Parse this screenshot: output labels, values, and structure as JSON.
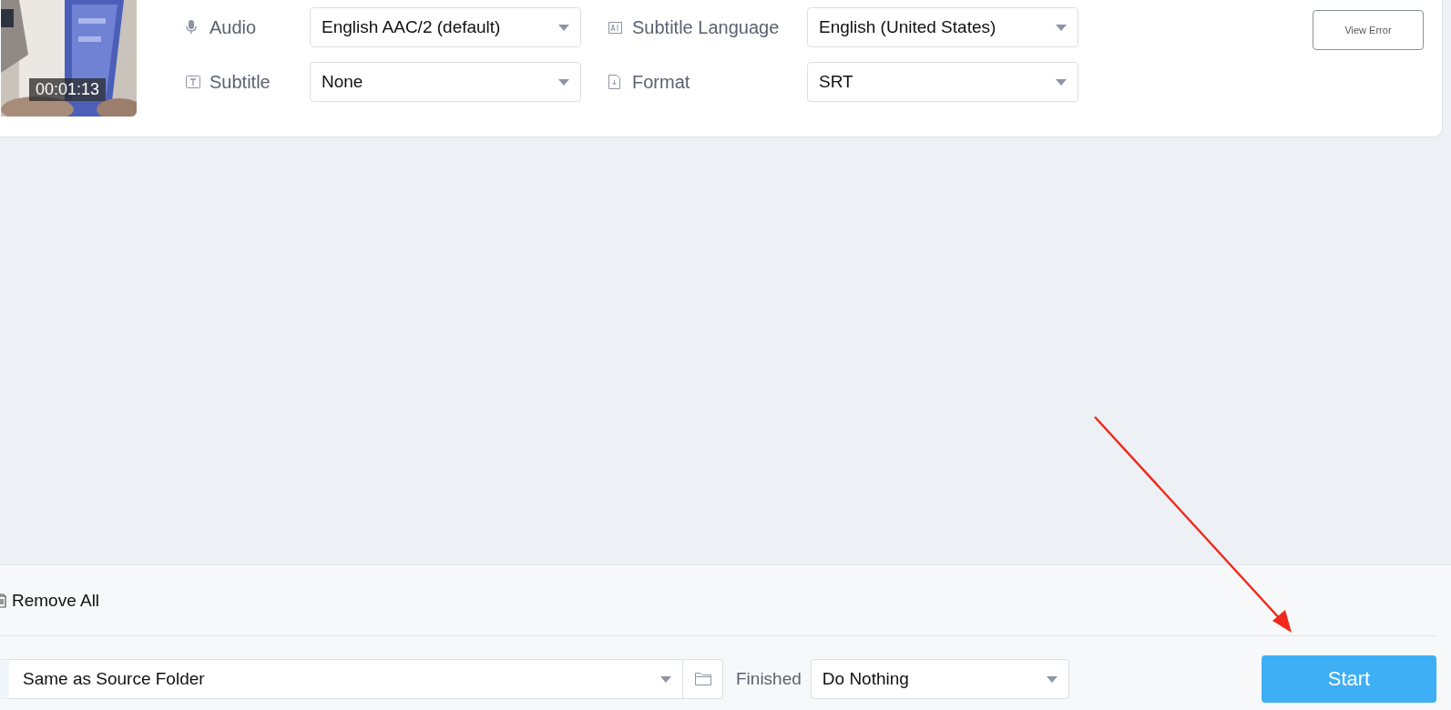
{
  "task": {
    "thumbnail": {
      "kind": "picture",
      "duration": "00:01:13"
    },
    "settings": [
      {
        "label": "Audio",
        "value": "English AAC/2 (default)"
      },
      {
        "label": "Subtitle Language",
        "value": "English (United States)"
      },
      {
        "label": "Subtitle",
        "value": "None"
      },
      {
        "label": "Format",
        "value": "SRT"
      }
    ],
    "view_error_button": "View Error"
  },
  "footer": {
    "remove_all": "Remove All",
    "output_folder": "Same as Source Folder",
    "finished_label": "Finished",
    "finished_value": "Do Nothing",
    "start_button": "Start"
  },
  "annotation": {
    "kind": "arrow"
  }
}
